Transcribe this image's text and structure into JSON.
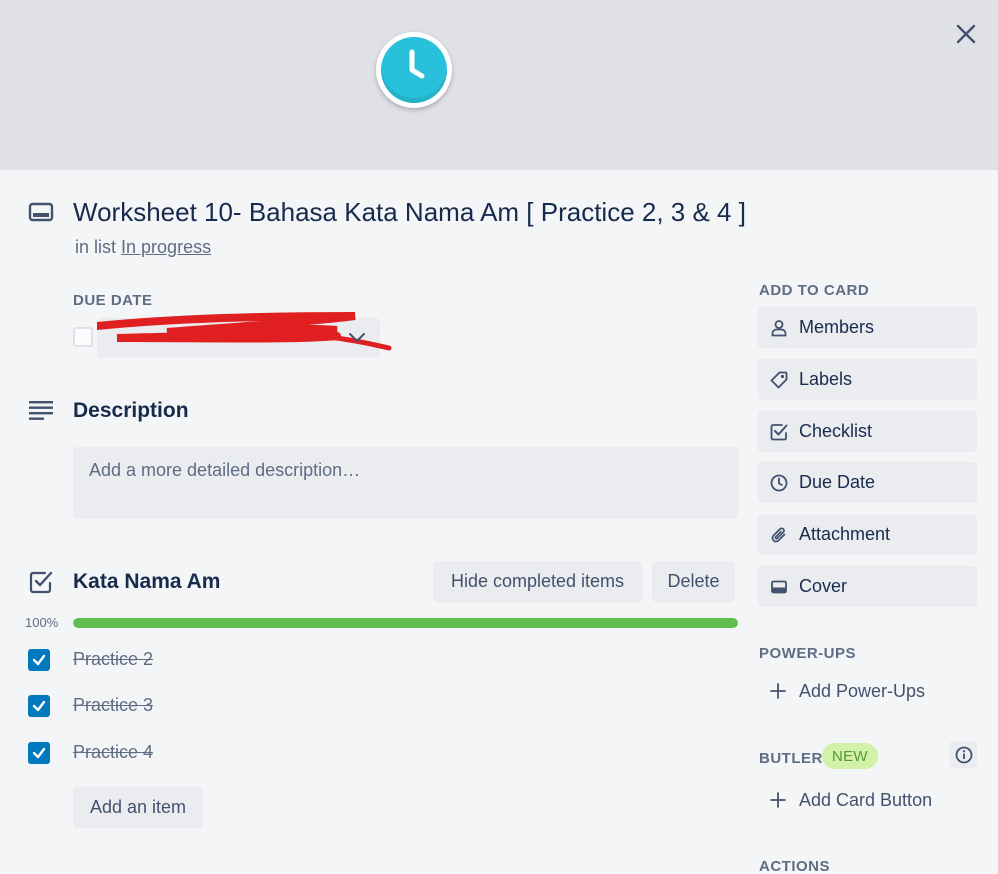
{
  "card": {
    "title": "Worksheet 10- Bahasa Kata Nama Am [ Practice 2, 3 & 4 ]",
    "in_list_prefix": "in list",
    "list_name": "In progress"
  },
  "due_date": {
    "label": "DUE DATE"
  },
  "description": {
    "title": "Description",
    "placeholder": "Add a more detailed description…"
  },
  "checklist": {
    "title": "Kata Nama Am",
    "hide_completed_label": "Hide completed items",
    "delete_label": "Delete",
    "progress_label": "100%",
    "progress_fraction": 1.0,
    "progress_color": "#61bd4f",
    "items": [
      {
        "label": "Practice 2",
        "checked": true
      },
      {
        "label": "Practice 3",
        "checked": true
      },
      {
        "label": "Practice 4",
        "checked": true
      }
    ],
    "add_item_label": "Add an item"
  },
  "sidebar": {
    "add_to_card_label": "ADD TO CARD",
    "buttons": [
      {
        "label": "Members",
        "icon": "person-icon"
      },
      {
        "label": "Labels",
        "icon": "tag-icon"
      },
      {
        "label": "Checklist",
        "icon": "checkbox-icon"
      },
      {
        "label": "Due Date",
        "icon": "clock-icon"
      },
      {
        "label": "Attachment",
        "icon": "paperclip-icon"
      },
      {
        "label": "Cover",
        "icon": "card-icon"
      }
    ],
    "power_ups_label": "POWER-UPS",
    "add_power_ups_label": "Add Power-Ups",
    "butler_label": "BUTLER",
    "new_badge": "NEW",
    "add_card_button_label": "Add Card Button",
    "actions_label": "ACTIONS"
  },
  "colors": {
    "accent_blue": "#0079bf",
    "cover_clock": "#29c0dc",
    "redaction": "#e02020"
  }
}
